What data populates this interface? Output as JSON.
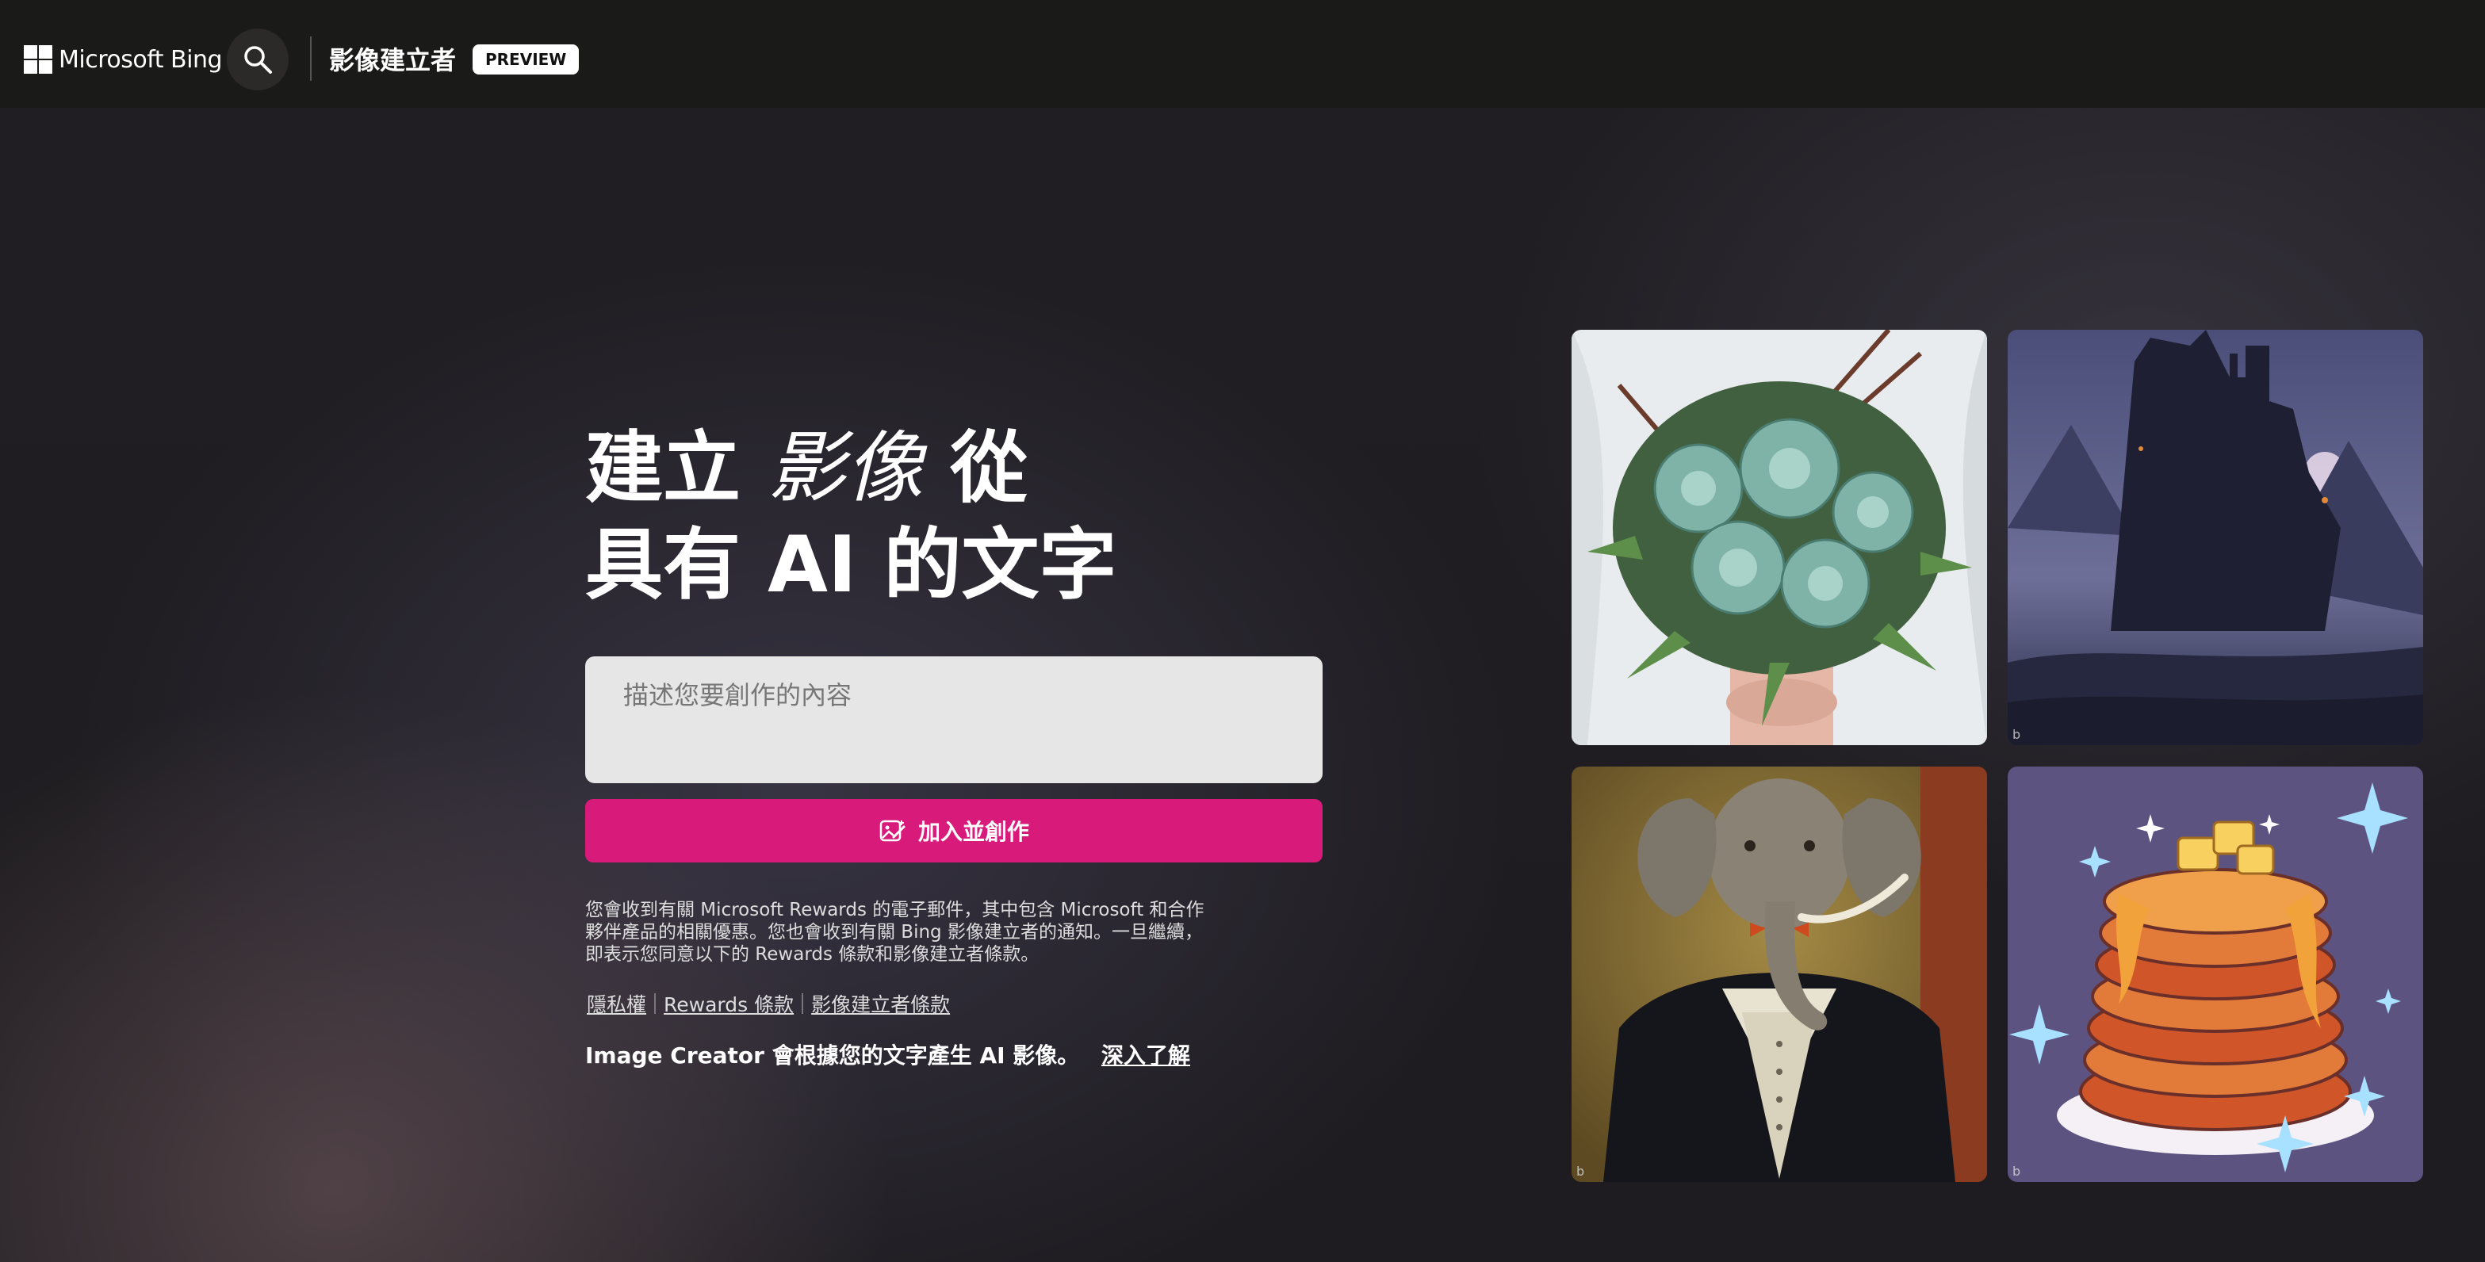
{
  "header": {
    "brand": "Microsoft Bing",
    "app_title": "影像建立者",
    "badge": "PREVIEW"
  },
  "hero": {
    "headline_part1": "建立",
    "headline_italic": "影像",
    "headline_part2": "從",
    "headline_line2": "具有 AI 的文字",
    "prompt_placeholder": "描述您要創作的內容",
    "create_button_label": "加入並創作",
    "notice": "您會收到有關 Microsoft Rewards 的電子郵件，其中包含 Microsoft 和合作夥伴產品的相關優惠。您也會收到有關 Bing 影像建立者的通知。一旦繼續，即表示您同意以下的 Rewards 條款和影像建立者條款。",
    "links": [
      "隱私權",
      "Rewards 條款",
      "影像建立者條款"
    ],
    "footer_text": "Image Creator 會根據您的文字產生 AI 影像。",
    "learn_more": "深入了解"
  },
  "gallery": {
    "watermark": "b"
  },
  "colors": {
    "accent": "#d81b7a",
    "header_bg": "#1a1a19",
    "prompt_bg": "#e6e6e6"
  },
  "icons": [
    "windows-logo-icon",
    "search-icon",
    "create-image-icon"
  ]
}
